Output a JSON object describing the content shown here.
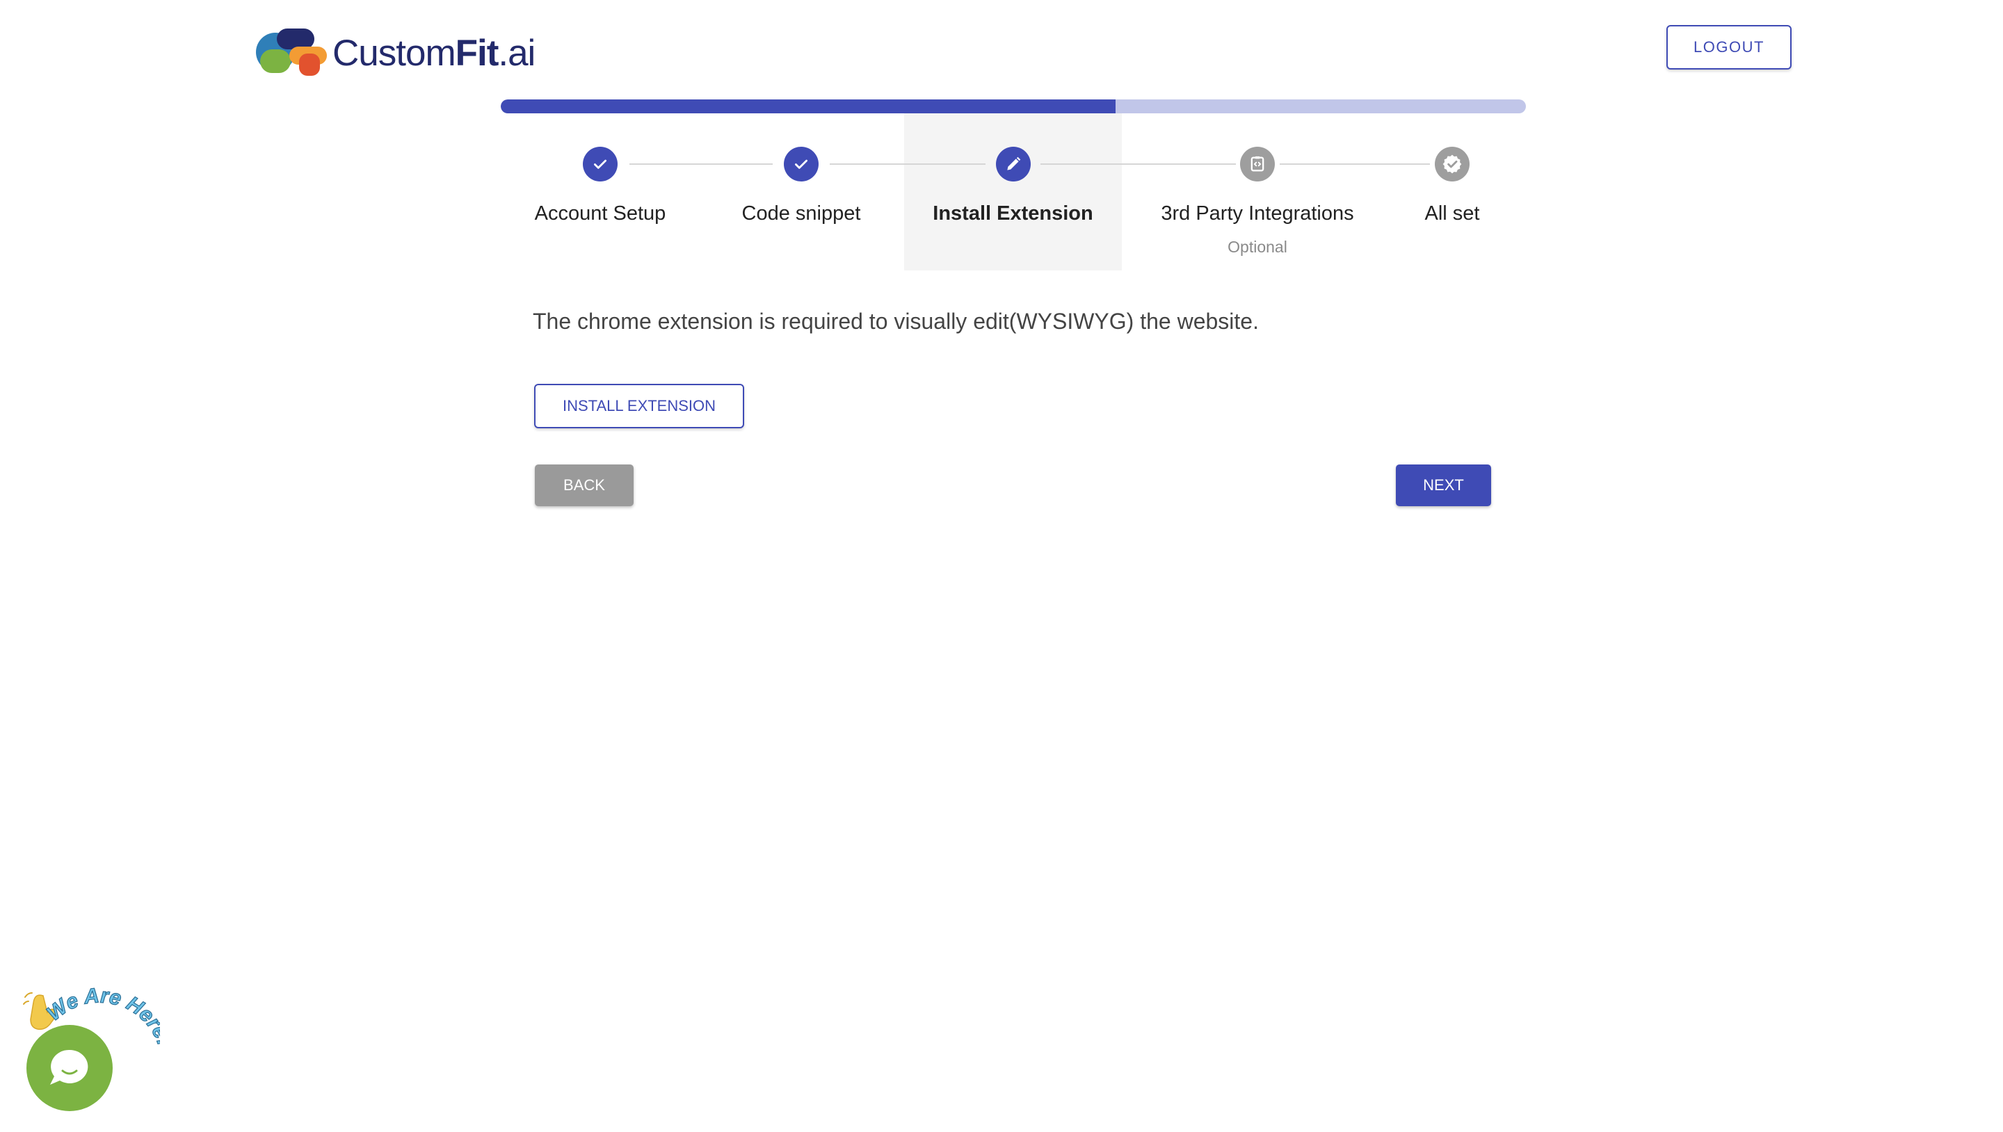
{
  "brand": {
    "name_part1": "Custom",
    "name_part2": "Fit",
    "name_part3": ".ai",
    "colors": {
      "primary": "#3f4bb5",
      "primary_light": "#c1c6e9",
      "logo_navy": "#232a6b",
      "chat_green": "#7cb342"
    }
  },
  "header": {
    "logout_label": "LOGOUT"
  },
  "progress": {
    "fraction": 0.6
  },
  "steps": [
    {
      "label": "Account Setup",
      "status": "done",
      "icon": "check-icon"
    },
    {
      "label": "Code snippet",
      "status": "done",
      "icon": "check-icon"
    },
    {
      "label": "Install Extension",
      "status": "current",
      "icon": "pencil-icon"
    },
    {
      "label": "3rd Party Integrations",
      "status": "pending",
      "icon": "code-icon",
      "sublabel": "Optional"
    },
    {
      "label": "All set",
      "status": "pending",
      "icon": "verified-badge-icon"
    }
  ],
  "content": {
    "description": "The chrome extension is required to visually edit(WYSIWYG) the website.",
    "install_button": "INSTALL EXTENSION",
    "back_button": "BACK",
    "next_button": "NEXT"
  },
  "chat_widget": {
    "badge_text": "We Are Here!",
    "icons": [
      "waving-hand-icon",
      "chat-bubble-icon"
    ]
  }
}
